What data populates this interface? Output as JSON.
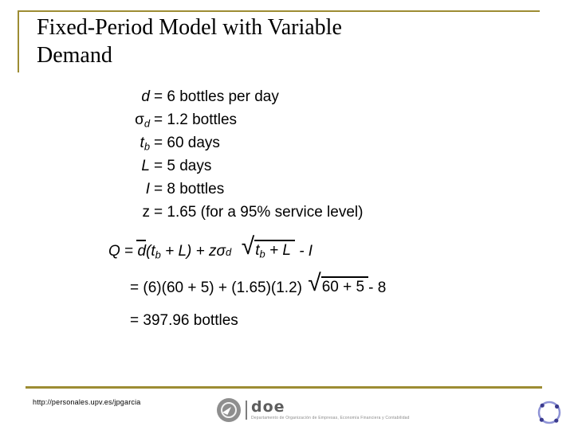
{
  "slide": {
    "title": "Fixed-Period Model with Variable Demand",
    "accent_color": "#9d8c33",
    "background_color": "#ffffff"
  },
  "given": {
    "rows": [
      {
        "symbol": "d",
        "subscript": "",
        "equals": "=",
        "value": "6 bottles per day"
      },
      {
        "symbol": "σ",
        "subscript": "d",
        "equals": "=",
        "value": "1.2 bottles"
      },
      {
        "symbol": "t",
        "subscript": "b",
        "equals": "=",
        "value": "60 days"
      },
      {
        "symbol": "L",
        "subscript": "",
        "equals": "=",
        "value": "5 days"
      },
      {
        "symbol": "I",
        "subscript": "",
        "equals": "=",
        "value": "8 bottles"
      },
      {
        "symbol": "z",
        "subscript": "",
        "equals": "=",
        "value": "1.65 (for a 95% service level)"
      }
    ]
  },
  "equations": {
    "line1": {
      "lhs": "Q",
      "eq": "=",
      "dbar": "d",
      "term1": "(t",
      "term1_sub": "b",
      "term1_rest": " + L) + zσ",
      "sigma_sub": "d",
      "radical_symbol": "√",
      "radicand_a": "t",
      "radicand_sub": "b",
      "radicand_rest": " + L",
      "tail": "- I"
    },
    "line2": {
      "eq": "=",
      "pre": "(6)(60 + 5) + (1.65)(1.2)",
      "radical_symbol": "√",
      "radicand": "60 + 5",
      "tail": "- 8"
    },
    "line3": {
      "eq": "=",
      "value": "397.96 bottles"
    }
  },
  "footer": {
    "url": "http://personales.upv.es/jpgarcia",
    "doe_word": "doe",
    "doe_subtitle": "Departamento de Organización de Empresas, Economía Financiera y Contabilidad"
  }
}
